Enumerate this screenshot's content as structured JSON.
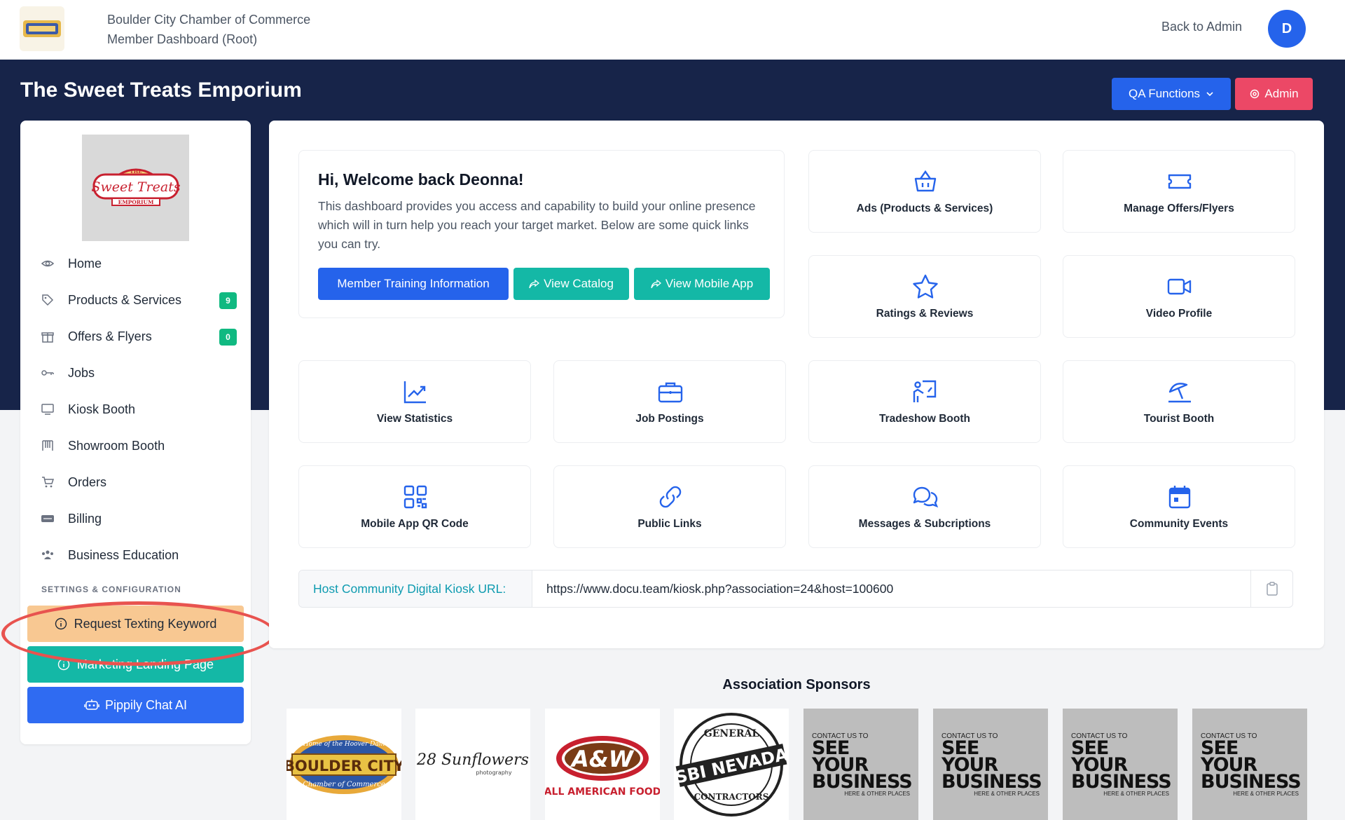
{
  "header": {
    "org_name": "Boulder City Chamber of Commerce",
    "dashboard_name": "Member Dashboard (Root)",
    "back_label": "Back to Admin",
    "avatar_initial": "D"
  },
  "title_bar": {
    "business_name": "The Sweet Treats Emporium",
    "qa_label": "QA Functions",
    "admin_label": "Admin"
  },
  "business_logo": {
    "line1": "THE",
    "line2": "Sweet Treats",
    "line3": "EMPORIUM"
  },
  "sidebar": {
    "items": [
      {
        "label": "Home",
        "icon": "eye-icon"
      },
      {
        "label": "Products & Services",
        "icon": "tag-icon",
        "badge": "9"
      },
      {
        "label": "Offers & Flyers",
        "icon": "gift-icon",
        "badge": "0"
      },
      {
        "label": "Jobs",
        "icon": "key-icon"
      },
      {
        "label": "Kiosk Booth",
        "icon": "monitor-icon"
      },
      {
        "label": "Showroom Booth",
        "icon": "showroom-icon"
      },
      {
        "label": "Orders",
        "icon": "cart-icon"
      },
      {
        "label": "Billing",
        "icon": "stripe-icon"
      },
      {
        "label": "Business Education",
        "icon": "users-icon"
      }
    ],
    "settings_label": "SETTINGS & CONFIGURATION",
    "request_keyword": "Request Texting Keyword",
    "marketing_landing": "Marketing Landing Page",
    "chat_ai": "Pippily Chat AI"
  },
  "welcome": {
    "heading": "Hi, Welcome back Deonna!",
    "body": "This dashboard provides you access and capability to build your online presence which will in turn help you reach your target market. Below are some quick links you can try.",
    "btn_training": "Member Training Information",
    "btn_catalog": "View Catalog",
    "btn_mobile": "View Mobile App"
  },
  "tiles": [
    {
      "label": "Ads (Products & Services)",
      "icon": "basket-icon"
    },
    {
      "label": "Manage Offers/Flyers",
      "icon": "ticket-icon"
    },
    {
      "label": "Ratings & Reviews",
      "icon": "star-icon"
    },
    {
      "label": "Video Profile",
      "icon": "video-icon"
    },
    {
      "label": "View Statistics",
      "icon": "chart-icon"
    },
    {
      "label": "Job Postings",
      "icon": "briefcase-icon"
    },
    {
      "label": "Tradeshow Booth",
      "icon": "presentation-icon"
    },
    {
      "label": "Tourist Booth",
      "icon": "umbrella-icon"
    },
    {
      "label": "Mobile App QR Code",
      "icon": "qr-icon"
    },
    {
      "label": "Public Links",
      "icon": "link-icon"
    },
    {
      "label": "Messages & Subcriptions",
      "icon": "chat-icon"
    },
    {
      "label": "Community Events",
      "icon": "calendar-icon"
    }
  ],
  "kiosk": {
    "label": "Host Community Digital Kiosk URL:",
    "url": "https://www.docu.team/kiosk.php?association=24&host=100600"
  },
  "sponsors": {
    "title": "Association Sponsors",
    "logos": [
      {
        "top": "Home of the Hoover Dam",
        "main": "BOULDER CITY",
        "sub": "Chamber of Commerce"
      },
      {
        "main": "28 Sunflowers",
        "sub": "photography"
      },
      {
        "main": "A&W",
        "sub": "ALL AMERICAN FOOD"
      },
      {
        "top": "GENERAL",
        "main": "SBI NEVADA",
        "sub": "CONTRACTORS"
      }
    ],
    "placeholder": {
      "small": "CONTACT US TO",
      "big1": "SEE YOUR",
      "big2": "BUSINESS",
      "foot": "HERE & OTHER PLACES"
    }
  }
}
